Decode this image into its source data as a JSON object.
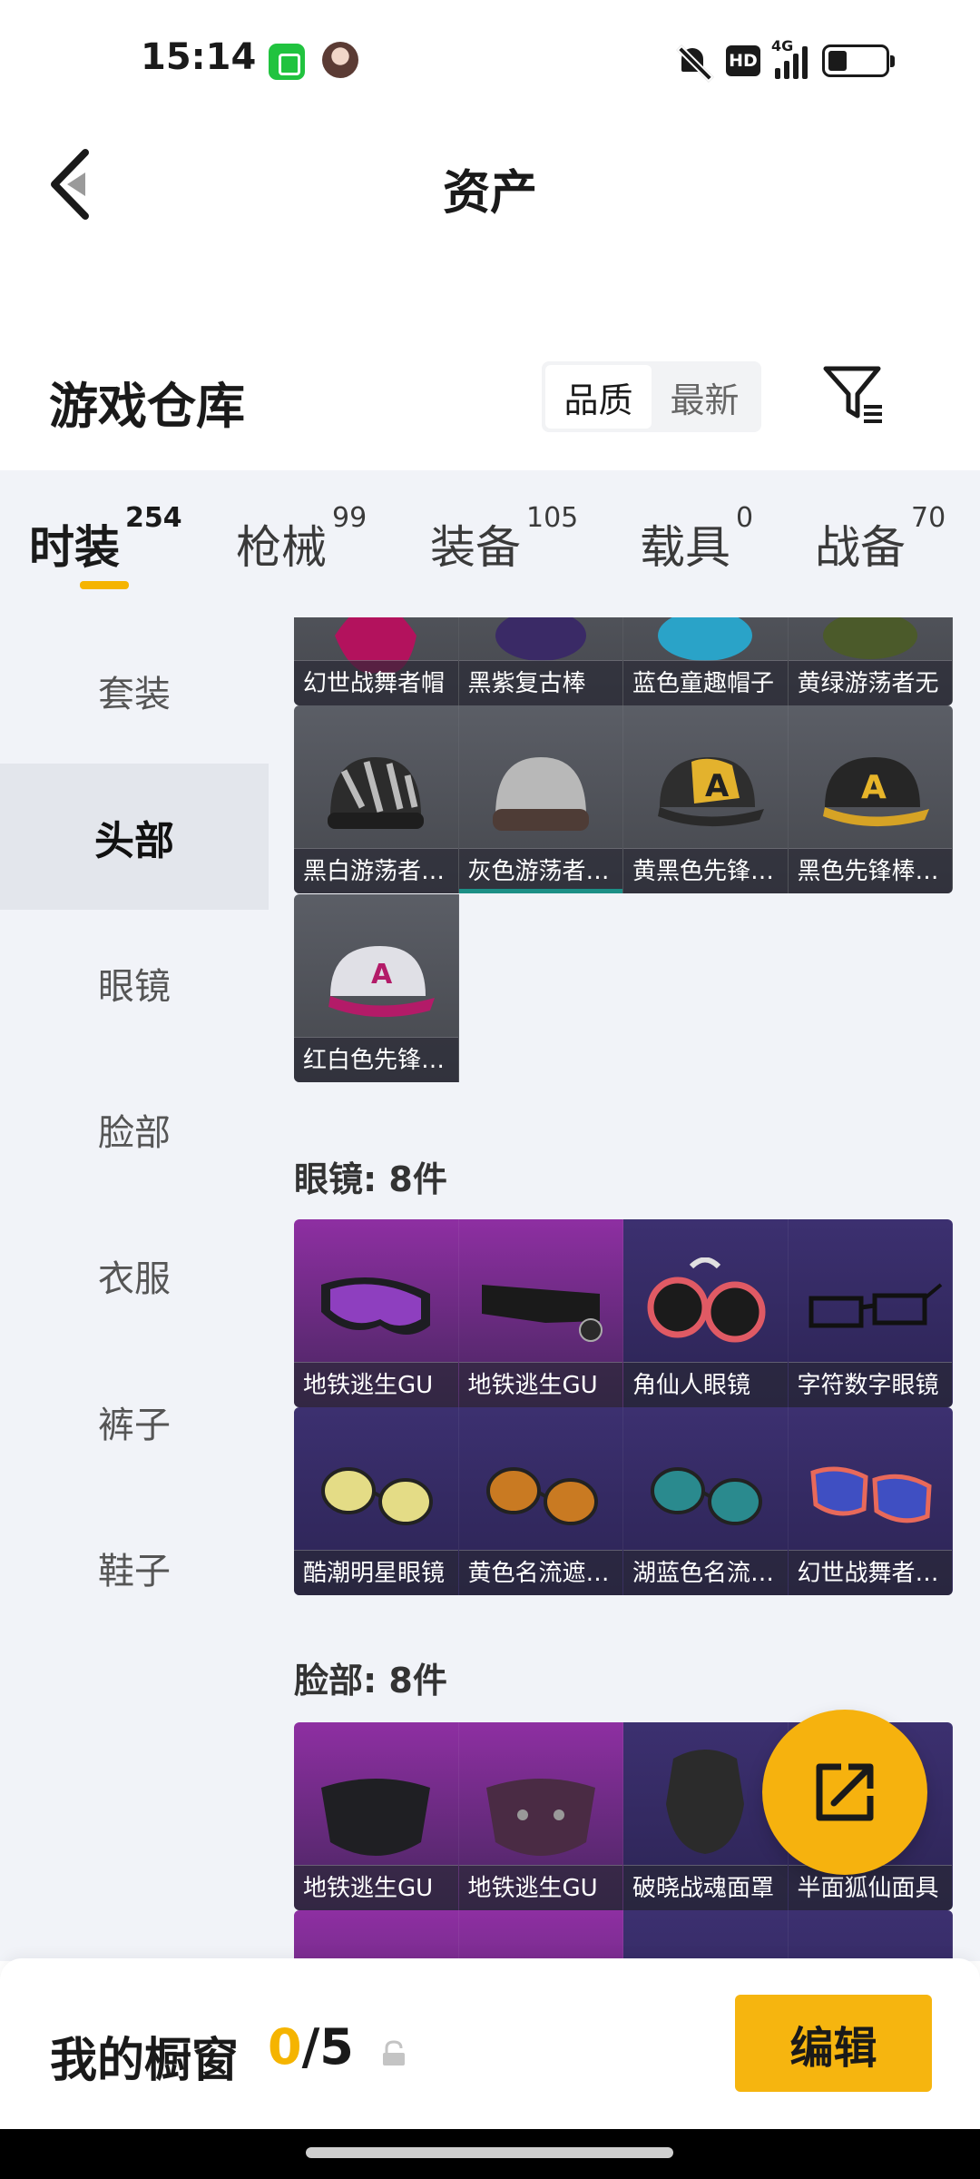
{
  "status_bar": {
    "time": "15:14",
    "network": "4G"
  },
  "header": {
    "title": "资产"
  },
  "warehouse": {
    "title": "游戏仓库",
    "sort_options": [
      "品质",
      "最新"
    ],
    "active_sort": "品质"
  },
  "tabs": [
    {
      "label": "时装",
      "count": "254",
      "active": true
    },
    {
      "label": "枪械",
      "count": "99"
    },
    {
      "label": "装备",
      "count": "105"
    },
    {
      "label": "载具",
      "count": "0"
    },
    {
      "label": "战备",
      "count": "70"
    }
  ],
  "categories": [
    "套装",
    "头部",
    "眼镜",
    "脸部",
    "衣服",
    "裤子",
    "鞋子"
  ],
  "active_category": "头部",
  "head_items_row1": [
    "幻世战舞者帽",
    "黑紫复古棒",
    "蓝色童趣帽子",
    "黄绿游荡者无"
  ],
  "head_items_row2": [
    "黑白游荡者无…",
    "灰色游荡者…",
    "黄黑色先锋…",
    "黑色先锋棒球…"
  ],
  "head_items_row3": [
    "红白色先锋棒…"
  ],
  "glasses_section": {
    "title": "眼镜: 8件"
  },
  "glasses_row1": [
    "地铁逃生GU",
    "地铁逃生GU",
    "角仙人眼镜",
    "字符数字眼镜"
  ],
  "glasses_row2": [
    "酷潮明星眼镜",
    "黄色名流遮…",
    "湖蓝色名流…",
    "幻世战舞者眼…"
  ],
  "face_section": {
    "title": "脸部: 8件"
  },
  "face_row1": [
    "地铁逃生GU",
    "地铁逃生GU",
    "破晓战魂面罩",
    "半面狐仙面具"
  ],
  "showcase": {
    "label": "我的橱窗",
    "current": "0",
    "total": "/5"
  },
  "edit_button": "编辑",
  "colors": {
    "accent": "#f6b50f",
    "active_tab_underline": "#f5b400"
  }
}
